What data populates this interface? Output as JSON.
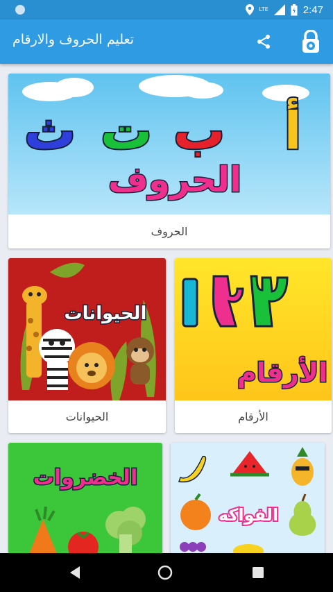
{
  "status_bar": {
    "network_label": "LTE",
    "time": "2:47"
  },
  "app_bar": {
    "title": "تعليم الحروف والارقام",
    "share_icon": "share-icon",
    "lock_icon": "lock-settings-icon"
  },
  "colors": {
    "status_bar": "#2a8fd0",
    "app_bar": "#2f9be3",
    "background": "#e9edf3"
  },
  "cards": {
    "letters": {
      "image_letters": [
        "أ",
        "ب",
        "ت",
        "ث"
      ],
      "image_title": "الحروف",
      "label": "الحروف"
    },
    "numbers": {
      "image_digits": "١٢٣",
      "image_title": "الأرقام",
      "label": "الأرقام"
    },
    "animals": {
      "image_title": "الحيوانات",
      "label": "الحيوانات"
    },
    "vegetables": {
      "image_title": "الخضروات"
    },
    "fruits": {
      "image_title": "الفواكه"
    }
  },
  "nav_bar": {
    "back_icon": "back-triangle-icon",
    "home_icon": "home-circle-icon",
    "recent_icon": "recent-apps-square-icon"
  }
}
